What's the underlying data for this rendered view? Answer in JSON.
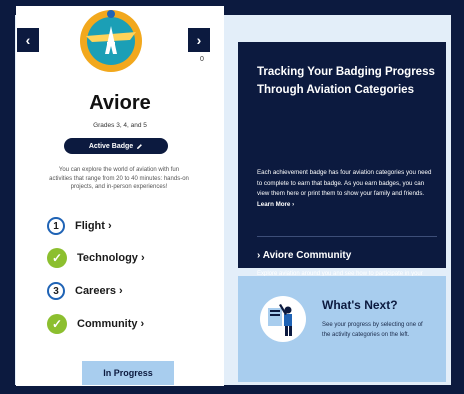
{
  "nav": {
    "prev_icon": "chevron-left-icon",
    "next_icon": "chevron-right-icon",
    "prev_glyph": "‹",
    "next_glyph": "›",
    "page_hint": "0"
  },
  "program": {
    "title": "Aviore",
    "grades": "Grades 3, 4, and 5",
    "badge_button": "Active Badge",
    "badge_icon": "pencil-icon",
    "description": "You can explore the world of aviation with fun activities that range from 20 to 40 minutes: hands-on projects, and in-person experiences!"
  },
  "categories": [
    {
      "label": "Flight ›",
      "state": "number",
      "marker": "1"
    },
    {
      "label": "Technology ›",
      "state": "complete",
      "marker": "✓"
    },
    {
      "label": "Careers ›",
      "state": "number",
      "marker": "3"
    },
    {
      "label": "Community ›",
      "state": "complete",
      "marker": "✓"
    }
  ],
  "status_button": "In Progress",
  "tracking": {
    "heading": "Tracking Your Badging Progress Through Aviation Categories",
    "body": "Each achievement badge has four aviation categories you need to complete to earn that badge. As you earn badges, you can view them here or print them to show your family and friends.",
    "learn_more": "Learn More ›",
    "community_link": "› Aviore Community",
    "community_text": "Explore aviation around you and see how to participate in your community!"
  },
  "whats_next": {
    "heading": "What's Next?",
    "body": "See your progress by selecting one of the activity categories on the left."
  },
  "colors": {
    "navy": "#0c1a3f",
    "light_blue": "#a8cdee",
    "green": "#8cbf2f",
    "ring_blue": "#1f63b5",
    "logo_gold": "#f2a81d",
    "logo_teal": "#1b9fb6"
  }
}
